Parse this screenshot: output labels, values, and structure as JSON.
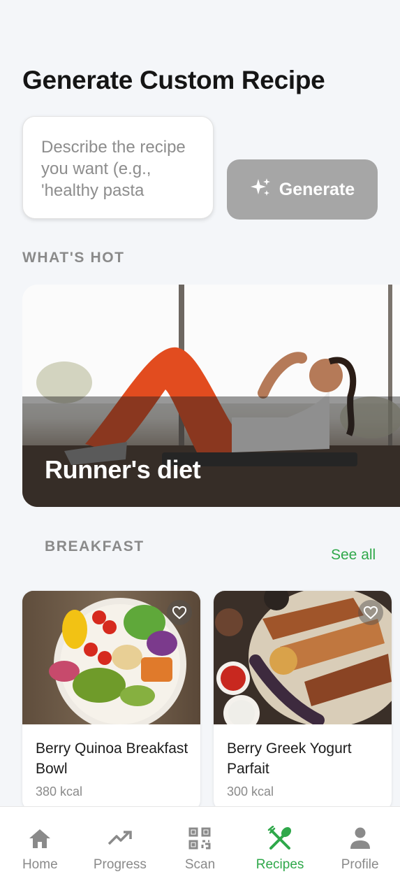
{
  "header": {
    "title": "Generate Custom Recipe"
  },
  "prompt": {
    "placeholder": "Describe the recipe you want (e.g., 'healthy pasta"
  },
  "generate": {
    "label": "Generate"
  },
  "whats_hot": {
    "section_label": "WHAT'S HOT",
    "card_title": "Runner's diet"
  },
  "breakfast": {
    "section_label": "BREAKFAST",
    "see_all": "See all",
    "recipes": [
      {
        "name": "Berry Quinoa Breakfast Bowl",
        "kcal": "380 kcal"
      },
      {
        "name": "Berry Greek Yogurt Parfait",
        "kcal": "300 kcal"
      }
    ]
  },
  "nav": {
    "items": [
      {
        "label": "Home",
        "icon": "home-icon"
      },
      {
        "label": "Progress",
        "icon": "trending-up-icon"
      },
      {
        "label": "Scan",
        "icon": "qr-code-icon"
      },
      {
        "label": "Recipes",
        "icon": "fork-spoon-icon"
      },
      {
        "label": "Profile",
        "icon": "person-icon"
      }
    ],
    "active": "Recipes",
    "active_color": "#2fa84a"
  }
}
